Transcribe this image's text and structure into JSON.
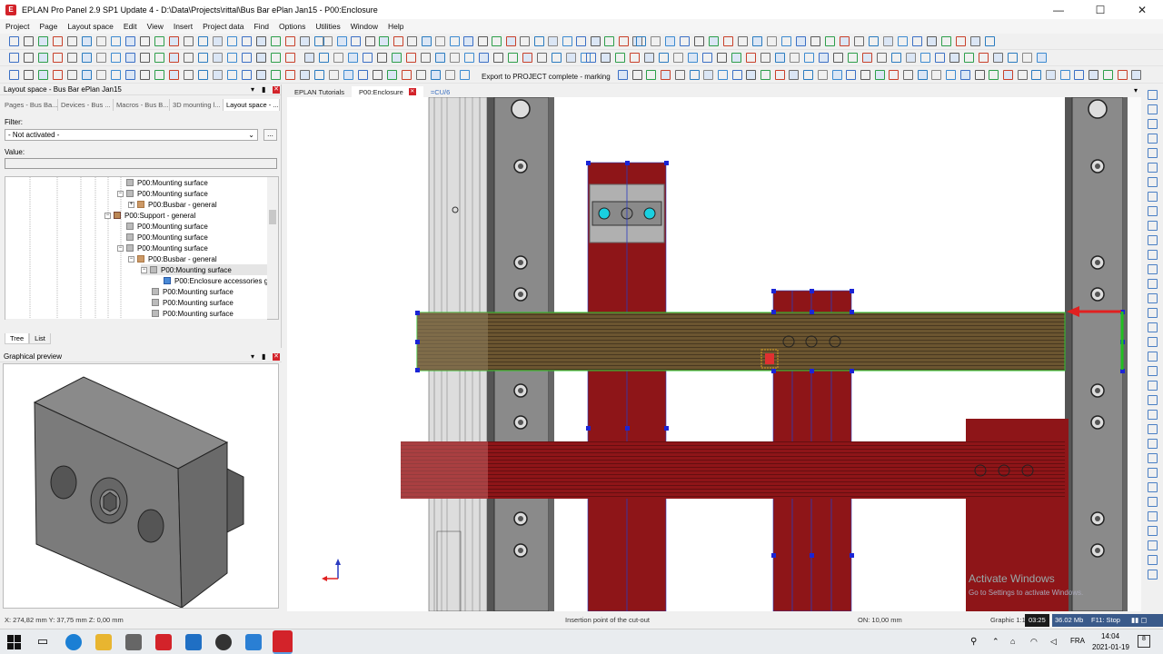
{
  "window": {
    "title": "EPLAN Pro Panel 2.9 SP1 Update 4 - D:\\Data\\Projects\\rittal\\Bus Bar ePlan Jan15 - P00:Enclosure",
    "app_icon": "eplan-logo-icon",
    "minimize": "—",
    "maximize": "☐",
    "close": "✕"
  },
  "menu": [
    "Project",
    "Page",
    "Layout space",
    "Edit",
    "View",
    "Insert",
    "Project data",
    "Find",
    "Options",
    "Utilities",
    "Window",
    "Help"
  ],
  "toolbar": {
    "export_label": "Export to PROJECT complete - marking"
  },
  "layout_panel": {
    "title": "Layout space - Bus Bar ePlan Jan15",
    "tabs": [
      "Pages - Bus Ba...",
      "Devices - Bus ...",
      "Macros - Bus B...",
      "3D mounting l...",
      "Layout space - ..."
    ],
    "filter_label": "Filter:",
    "filter_value": "- Not activated -",
    "filter_btn": "...",
    "value_label": "Value:",
    "tree": [
      {
        "label": "P00:Mounting surface",
        "type": "surf"
      },
      {
        "label": "P00:Mounting surface",
        "type": "surf"
      },
      {
        "label": "P00:Busbar - general",
        "type": "bus"
      },
      {
        "label": "P00:Support - general",
        "type": "sup"
      },
      {
        "label": "P00:Mounting surface",
        "type": "surf"
      },
      {
        "label": "P00:Mounting surface",
        "type": "surf"
      },
      {
        "label": "P00:Mounting surface",
        "type": "surf"
      },
      {
        "label": "P00:Busbar - general",
        "type": "bus"
      },
      {
        "label": "P00:Mounting surface",
        "type": "surf"
      },
      {
        "label": "P00:Enclosure accessories ge",
        "type": "acc"
      },
      {
        "label": "P00:Mounting surface",
        "type": "surf"
      },
      {
        "label": "P00:Mounting surface",
        "type": "surf"
      },
      {
        "label": "P00:Mounting surface",
        "type": "surf"
      }
    ],
    "bottom_tabs": [
      "Tree",
      "List"
    ]
  },
  "preview_panel": {
    "title": "Graphical preview"
  },
  "doc_tabs": [
    {
      "label": "EPLAN Tutorials"
    },
    {
      "label": "P00:Enclosure"
    },
    {
      "label": "=CU/6"
    }
  ],
  "status": {
    "coords": "X: 274,82 mm    Y: 37,75 mm    Z: 0,00 mm",
    "message": "Insertion point of the cut-out",
    "grid": "ON: 10,00 mm",
    "graphic": "Graphic 1:1",
    "time": "03:25",
    "memory": "36.02 Mb",
    "stop": "F11: Stop"
  },
  "watermark": {
    "title": "Activate Windows",
    "subtitle": "Go to Settings to activate Windows."
  },
  "taskbar": {
    "lang": "FRA",
    "clock": "14:04",
    "date": "2021-01-19",
    "badge": "8"
  }
}
